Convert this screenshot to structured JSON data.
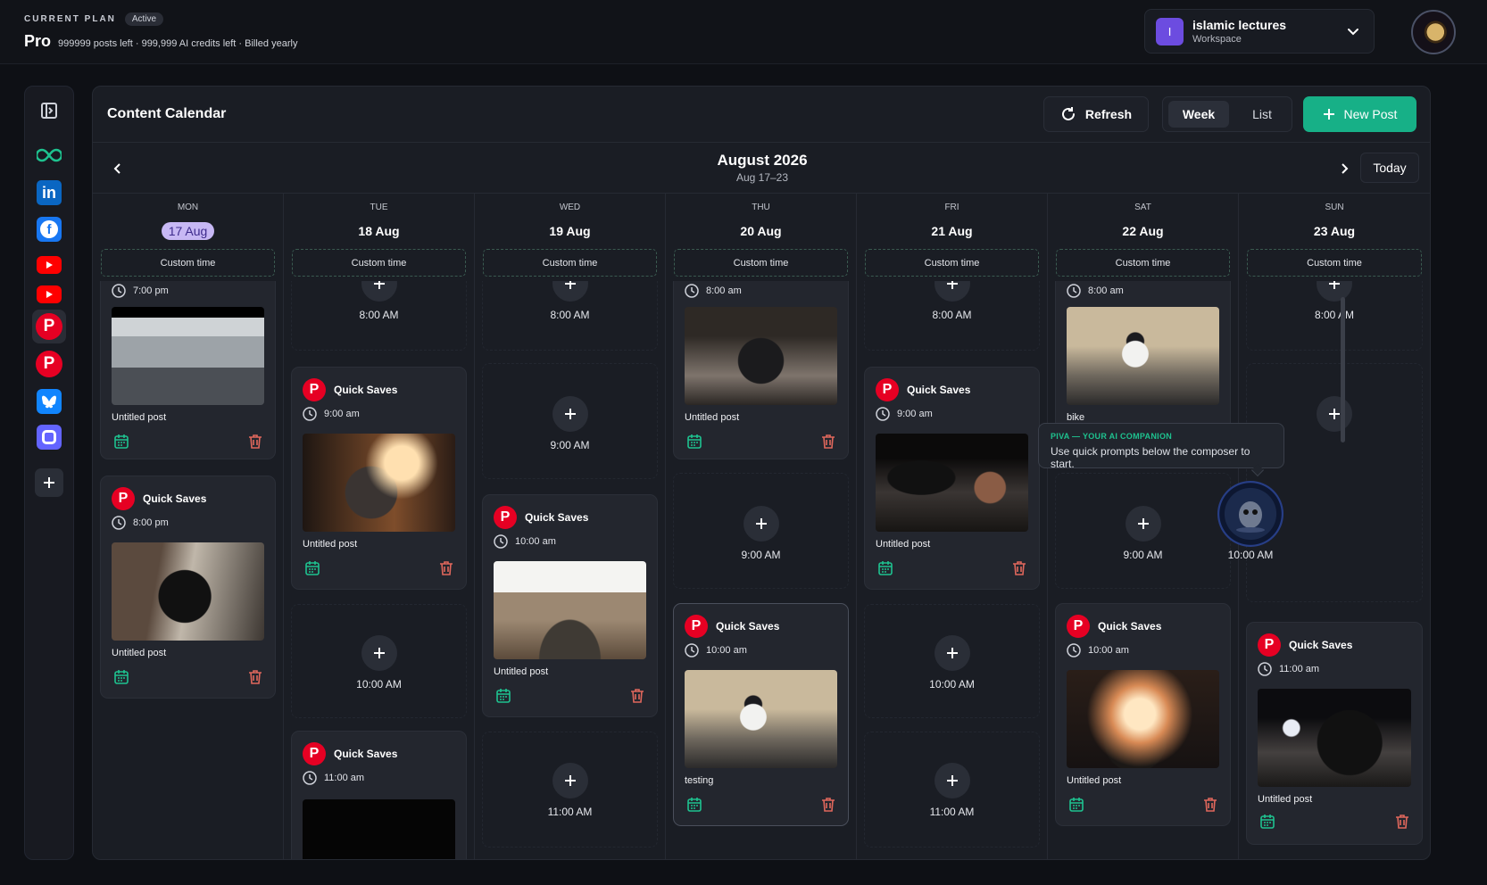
{
  "plan": {
    "label": "CURRENT PLAN",
    "status": "Active",
    "name": "Pro",
    "details": "999999 posts left · 999,999 AI credits left · Billed yearly"
  },
  "workspace": {
    "initial": "I",
    "name": "islamic lectures",
    "type": "Workspace"
  },
  "rail": {
    "items": [
      "sidebar-toggle-icon",
      "infinity-icon",
      "linkedin-icon",
      "facebook-icon",
      "youtube-icon",
      "youtube-icon",
      "pinterest-icon",
      "pinterest-icon",
      "bluesky-icon",
      "mastodon-icon",
      "plus-icon"
    ],
    "pinterest_letter": "P"
  },
  "header": {
    "title": "Content Calendar",
    "refresh_label": "Refresh",
    "view_week": "Week",
    "view_list": "List",
    "new_post_label": "New Post"
  },
  "nav": {
    "month": "August 2026",
    "range": "Aug 17–23",
    "today_label": "Today"
  },
  "days": [
    {
      "name": "MON",
      "date": "17 Aug",
      "custom": "Custom time",
      "cards": [
        {
          "account": "Quick Saves",
          "time": "8:00 pm",
          "caption": "Untitled post"
        }
      ],
      "partial_time": "7:00 pm",
      "partial_caption": "Untitled post"
    },
    {
      "name": "TUE",
      "date": "18 Aug",
      "custom": "Custom time",
      "cards": [
        {
          "account": "Quick Saves",
          "time": "9:00 am",
          "caption": "Untitled post"
        },
        {
          "account": "Quick Saves",
          "time": "11:00 am"
        }
      ],
      "slots": [
        "8:00 AM",
        "10:00 AM"
      ]
    },
    {
      "name": "WED",
      "date": "19 Aug",
      "custom": "Custom time",
      "cards": [
        {
          "account": "Quick Saves",
          "time": "10:00 am",
          "caption": "Untitled post"
        }
      ],
      "slots": [
        "8:00 AM",
        "9:00 AM",
        "11:00 AM"
      ]
    },
    {
      "name": "THU",
      "date": "20 Aug",
      "custom": "Custom time",
      "cards": [
        {
          "account": "Quick Saves",
          "time": "10:00 am",
          "caption": "testing"
        }
      ],
      "partial_time": "8:00 am",
      "partial_caption": "Untitled post",
      "slots": [
        "9:00 AM"
      ]
    },
    {
      "name": "FRI",
      "date": "21 Aug",
      "custom": "Custom time",
      "cards": [
        {
          "account": "Quick Saves",
          "time": "9:00 am",
          "caption": "Untitled post"
        }
      ],
      "slots": [
        "8:00 AM",
        "10:00 AM",
        "11:00 AM"
      ]
    },
    {
      "name": "SAT",
      "date": "22 Aug",
      "custom": "Custom time",
      "cards": [
        {
          "account": "Quick Saves",
          "time": "10:00 am",
          "caption": "Untitled post"
        }
      ],
      "partial_time": "8:00 am",
      "partial_caption": "bike",
      "slots": [
        "9:00 AM"
      ]
    },
    {
      "name": "SUN",
      "date": "23 Aug",
      "custom": "Custom time",
      "cards": [
        {
          "account": "Quick Saves",
          "time": "11:00 am",
          "caption": "Untitled post"
        }
      ],
      "slots": [
        "8:00 AM",
        "10:00 AM"
      ]
    }
  ],
  "tooltip": {
    "title": "PIVA — YOUR AI COMPANION",
    "text": "Use quick prompts below the composer to start."
  }
}
